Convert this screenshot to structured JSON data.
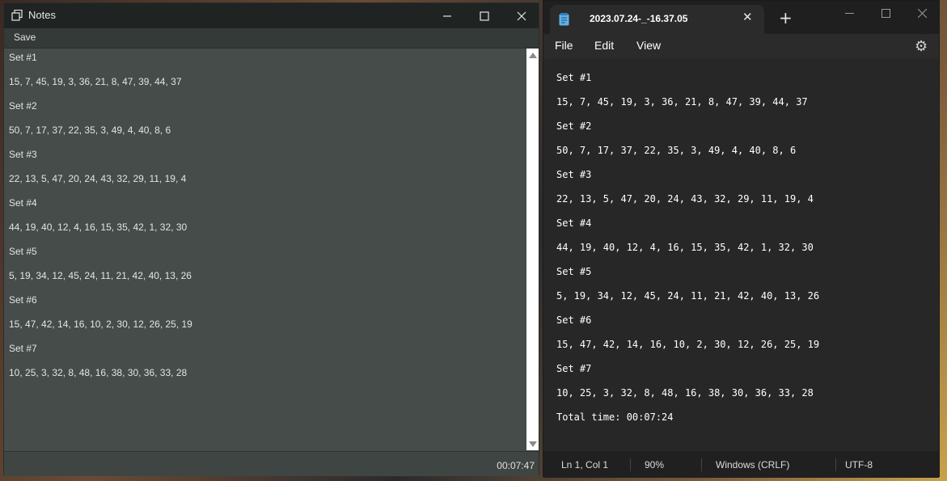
{
  "notes_window": {
    "title": "Notes",
    "icons": {
      "app": "notes-window-icon",
      "minimize": "minimize-icon",
      "maximize": "maximize-icon",
      "close": "close-icon"
    },
    "menu": {
      "save_label": "Save"
    },
    "lines": [
      "Set #1",
      "15, 7, 45, 19, 3, 36, 21, 8, 47, 39, 44, 37",
      "Set #2",
      "50, 7, 17, 37, 22, 35, 3, 49, 4, 40, 8, 6",
      "Set #3",
      "22, 13, 5, 47, 20, 24, 43, 32, 29, 11, 19, 4",
      "Set #4",
      "44, 19, 40, 12, 4, 16, 15, 35, 42, 1, 32, 30",
      "Set #5",
      "5, 19, 34, 12, 45, 24, 11, 21, 42, 40, 13, 26",
      "Set #6",
      "15, 47, 42, 14, 16, 10, 2, 30, 12, 26, 25, 19",
      "Set #7",
      "10, 25, 3, 32, 8, 48, 16, 38, 30, 36, 33, 28"
    ],
    "status": {
      "timer": "00:07:47"
    }
  },
  "notepad_window": {
    "tab_title": "2023.07.24-_-16.37.05",
    "icons": {
      "tab": "notepad-file-icon",
      "close_tab": "close-icon",
      "new_tab": "plus-icon",
      "settings": "gear-icon"
    },
    "menu": [
      "File",
      "Edit",
      "View"
    ],
    "lines": [
      "Set #1",
      "15, 7, 45, 19, 3, 36, 21, 8, 47, 39, 44, 37",
      "Set #2",
      "50, 7, 17, 37, 22, 35, 3, 49, 4, 40, 8, 6",
      "Set #3",
      "22, 13, 5, 47, 20, 24, 43, 32, 29, 11, 19, 4",
      "Set #4",
      "44, 19, 40, 12, 4, 16, 15, 35, 42, 1, 32, 30",
      "Set #5",
      "5, 19, 34, 12, 45, 24, 11, 21, 42, 40, 13, 26",
      "Set #6",
      "15, 47, 42, 14, 16, 10, 2, 30, 12, 26, 25, 19",
      "Set #7",
      "10, 25, 3, 32, 8, 48, 16, 38, 30, 36, 33, 28",
      "Total time: 00:07:24"
    ],
    "status": {
      "position": "Ln 1, Col 1",
      "zoom": "90%",
      "line_ending": "Windows (CRLF)",
      "encoding": "UTF-8"
    }
  }
}
